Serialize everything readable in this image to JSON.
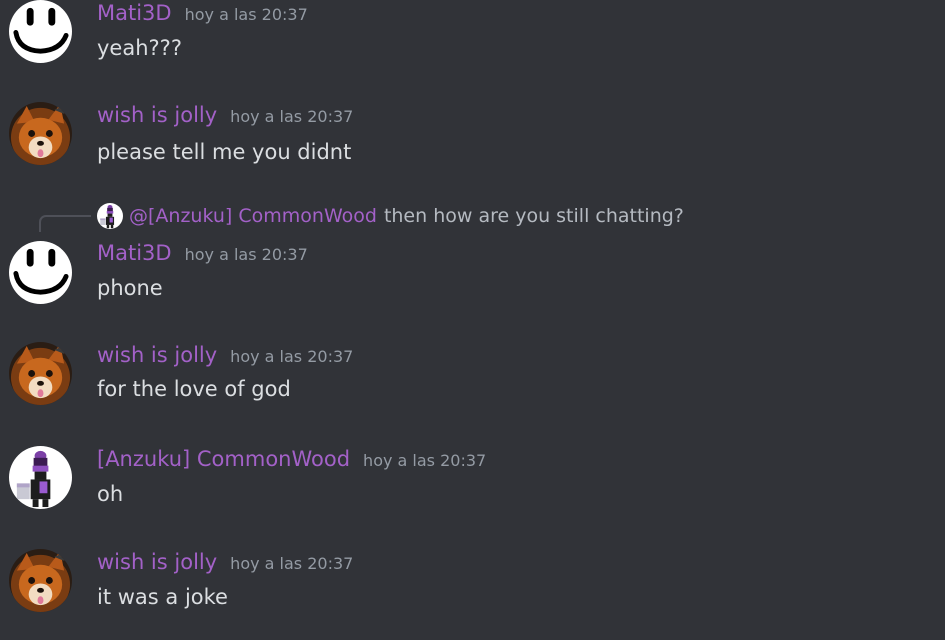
{
  "messages": [
    {
      "username": "Mati3D",
      "timestamp": "hoy a las 20:37",
      "content": "yeah???",
      "avatar_icon": "smiley-face-avatar"
    },
    {
      "username": "wish is jolly",
      "timestamp": "hoy a las 20:37",
      "content": "please tell me you didnt",
      "avatar_icon": "fox-witch-avatar"
    },
    {
      "reply": {
        "mention": "@[Anzuku] CommonWood",
        "text": "then how are you still chatting?",
        "avatar_icon": "purple-figure-avatar"
      },
      "username": "Mati3D",
      "timestamp": "hoy a las 20:37",
      "content": "phone",
      "avatar_icon": "smiley-face-avatar"
    },
    {
      "username": "wish is jolly",
      "timestamp": "hoy a las 20:37",
      "content": "for the love of god",
      "avatar_icon": "fox-witch-avatar"
    },
    {
      "username": "[Anzuku] CommonWood",
      "timestamp": "hoy a las 20:37",
      "content": "oh",
      "avatar_icon": "purple-figure-avatar"
    },
    {
      "username": "wish is jolly",
      "timestamp": "hoy a las 20:37",
      "content": "it was a joke",
      "avatar_icon": "fox-witch-avatar"
    }
  ],
  "colors": {
    "background": "#313338",
    "username": "#a361c8",
    "text": "#dbdee1",
    "timestamp": "#949ba4"
  }
}
